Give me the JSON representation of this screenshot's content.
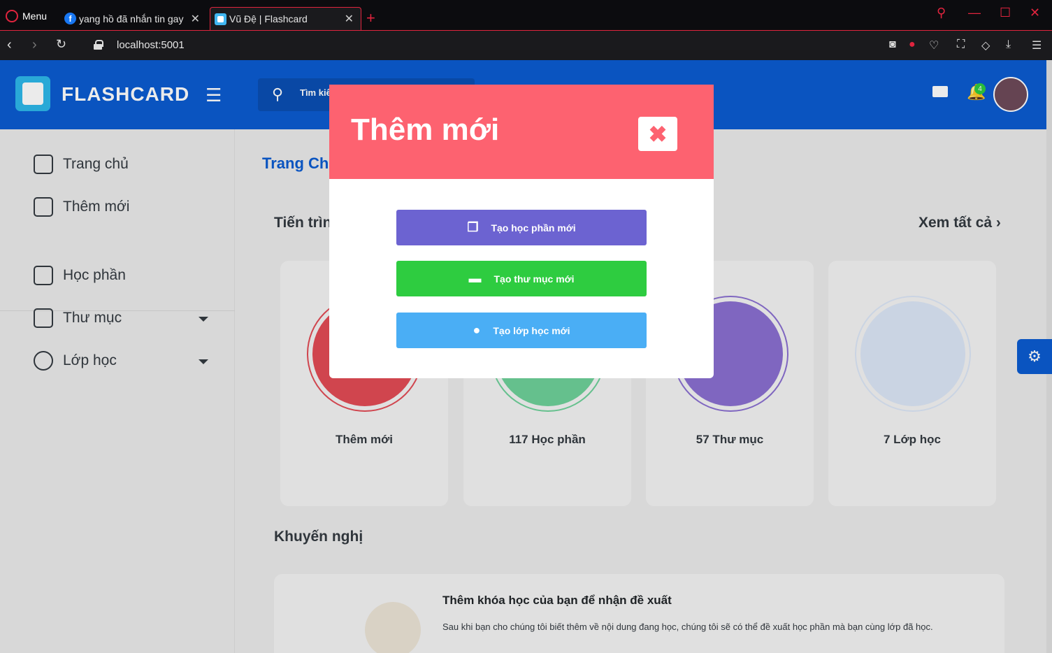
{
  "browser": {
    "menu_label": "Menu",
    "tabs": [
      {
        "title": "yang hồ đã nhắn tin gay",
        "favicon": "facebook-icon"
      },
      {
        "title": "Vũ Đệ | Flashcard",
        "favicon": "flashcard-icon"
      }
    ],
    "url": "localhost:5001",
    "accent_color": "#e0243e"
  },
  "header": {
    "brand": "FLASHCARD",
    "search_placeholder": "Tìm kiếm",
    "notification_count": "4",
    "brand_color": "#0b5cd1"
  },
  "sidebar": {
    "items": [
      {
        "label": "Trang chủ",
        "icon": "home-icon"
      },
      {
        "label": "Thêm mới",
        "icon": "edit-icon"
      },
      {
        "label": "Học phần",
        "icon": "copy-icon"
      },
      {
        "label": "Thư mục",
        "icon": "folder-icon"
      },
      {
        "label": "Lớp học",
        "icon": "user-icon"
      }
    ]
  },
  "main": {
    "breadcrumb": "Trang Chủ",
    "progress_title": "Tiến trình",
    "see_all": "Xem tất cả",
    "cards": [
      {
        "label": "Thêm mới",
        "color": "#e24b55"
      },
      {
        "label": "117 Học phần",
        "color": "#6ed19a"
      },
      {
        "label": "57 Thư mục",
        "color": "#8a6fd1"
      },
      {
        "label": "7 Lớp học",
        "color": "#a9c3f2"
      }
    ],
    "recommend_title": "Khuyến nghị",
    "recommend_card": {
      "title": "Thêm khóa học của bạn để nhận đề xuất",
      "text": "Sau khi bạn cho chúng tôi biết thêm về nội dung đang học, chúng tôi sẽ có thể đề xuất học phần mà bạn cùng lớp đã học."
    }
  },
  "modal": {
    "title": "Thêm mới",
    "close_icon": "close-icon",
    "buttons": [
      {
        "label": "Tạo học phần mới",
        "icon": "copy-icon",
        "color": "#6c63d1"
      },
      {
        "label": "Tạo thư mục mới",
        "icon": "folder-icon",
        "color": "#2ecc40"
      },
      {
        "label": "Tạo lớp học mới",
        "icon": "user-icon",
        "color": "#4aaef5"
      }
    ],
    "header_color": "#fd6270"
  }
}
